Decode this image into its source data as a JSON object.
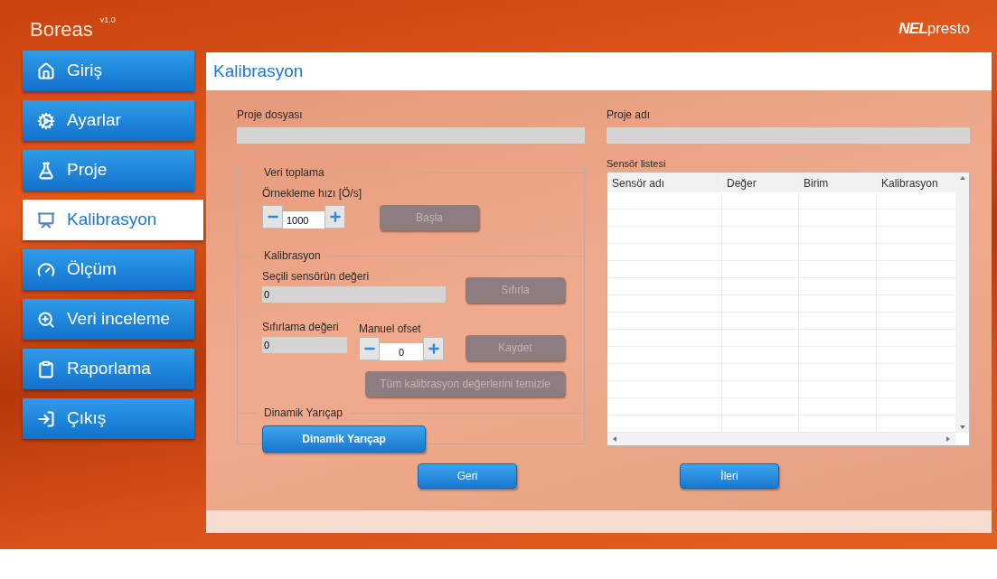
{
  "header": {
    "app_name": "Boreas",
    "version": "v1.0",
    "brand_mark": "NEL",
    "brand_name": "presto"
  },
  "nav": [
    {
      "label": "Giriş",
      "kind": "home",
      "selected": false
    },
    {
      "label": "Ayarlar",
      "kind": "settings",
      "selected": false
    },
    {
      "label": "Proje",
      "kind": "project",
      "selected": false
    },
    {
      "label": "Kalibrasyon",
      "kind": "calibration",
      "selected": true
    },
    {
      "label": "Ölçüm",
      "kind": "measurement",
      "selected": false
    },
    {
      "label": "Veri inceleme",
      "kind": "review",
      "selected": false
    },
    {
      "label": "Raporlama",
      "kind": "report",
      "selected": false
    },
    {
      "label": "Çıkış",
      "kind": "exit",
      "selected": false
    }
  ],
  "page": {
    "title": "Kalibrasyon",
    "project_file": {
      "label": "Proje dosyası"
    },
    "project_name": {
      "label": "Proje adı"
    },
    "data_collection": {
      "legend": "Veri toplama",
      "rate_label": "Örnekleme hızı [Ö/s]",
      "rate_value": "1000",
      "start_button": {
        "label": "Başla",
        "disabled": true
      }
    },
    "calibration": {
      "legend": "Kalibrasyon",
      "sensor_value_label": "Seçili sensörün değeri",
      "sensor_value": "0",
      "reset_button": {
        "label": "Sıfırla",
        "disabled": true
      },
      "reset_value_label": "Sıfırlama değeri",
      "reset_value": "0",
      "offset_label": "Manuel ofset",
      "offset_value": "0",
      "save_button": {
        "label": "Kaydet",
        "disabled": true
      },
      "clear_button": {
        "label": "Tüm kalibrasyon değerlerini temizle",
        "disabled": true
      }
    },
    "dynamic_radius": {
      "legend": "Dinamik Yarıçap",
      "button": {
        "label": "Dinamik Yarıçap",
        "disabled": false
      }
    },
    "sensor_list": {
      "label": "Sensör listesi",
      "columns": [
        "Sensör adı",
        "Değer",
        "Birim",
        "Kalibrasyon"
      ]
    },
    "back_button": {
      "label": "Geri",
      "disabled": false
    },
    "next_button": {
      "label": "İleri",
      "disabled": false
    }
  }
}
